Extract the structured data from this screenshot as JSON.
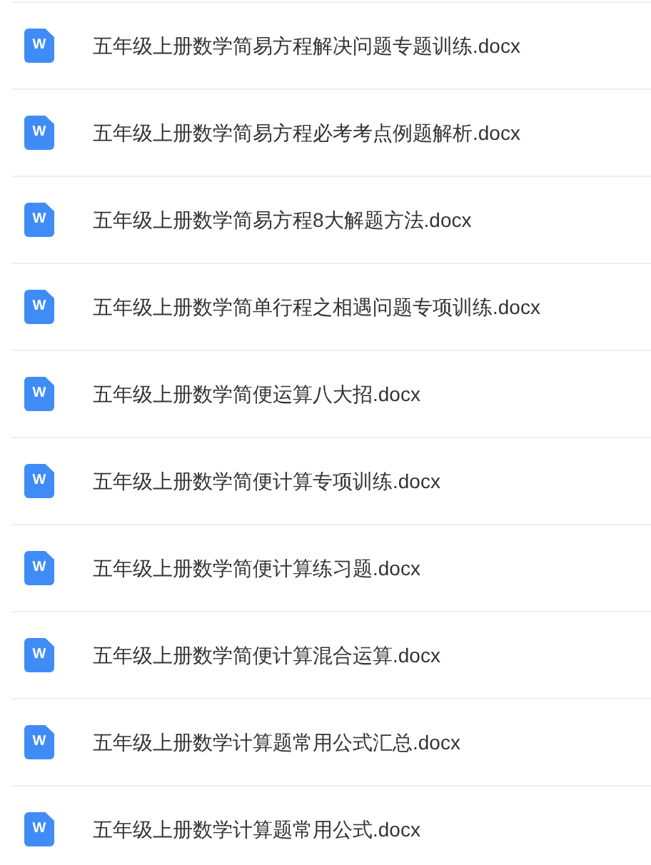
{
  "files": [
    {
      "icon_label": "W",
      "name": "五年级上册数学简易方程解决问题专题训练.docx"
    },
    {
      "icon_label": "W",
      "name": "五年级上册数学简易方程必考考点例题解析.docx"
    },
    {
      "icon_label": "W",
      "name": "五年级上册数学简易方程8大解题方法.docx"
    },
    {
      "icon_label": "W",
      "name": "五年级上册数学简单行程之相遇问题专项训练.docx"
    },
    {
      "icon_label": "W",
      "name": "五年级上册数学简便运算八大招.docx"
    },
    {
      "icon_label": "W",
      "name": "五年级上册数学简便计算专项训练.docx"
    },
    {
      "icon_label": "W",
      "name": "五年级上册数学简便计算练习题.docx"
    },
    {
      "icon_label": "W",
      "name": "五年级上册数学简便计算混合运算.docx"
    },
    {
      "icon_label": "W",
      "name": "五年级上册数学计算题常用公式汇总.docx"
    },
    {
      "icon_label": "W",
      "name": "五年级上册数学计算题常用公式.docx"
    }
  ]
}
